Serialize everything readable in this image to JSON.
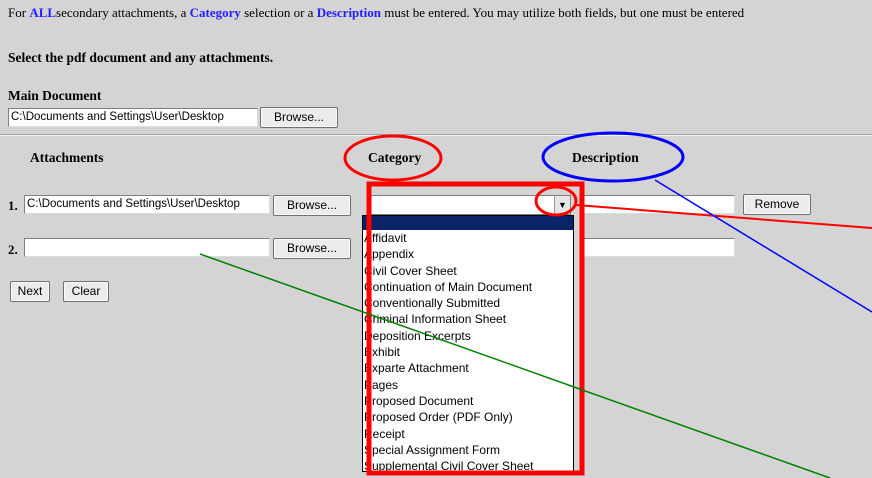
{
  "notice": {
    "prefix": "For ",
    "all": "ALL",
    "mid1": "secondary attachments, a ",
    "category": "Category",
    "mid2": " selection or a ",
    "description": "Description",
    "suffix": " must be entered. You may utilize both fields, but one must be entered"
  },
  "heading": "Select the pdf document and any attachments.",
  "main_document": {
    "label": "Main Document",
    "path": "C:\\Documents and Settings\\User\\Desktop",
    "browse": "Browse..."
  },
  "columns": {
    "attachments": "Attachments",
    "category": "Category",
    "description": "Description"
  },
  "attachments": [
    {
      "num": "1.",
      "path": "C:\\Documents and Settings\\User\\Desktop",
      "browse": "Browse...",
      "remove": "Remove",
      "description": ""
    },
    {
      "num": "2.",
      "path": "",
      "browse": "Browse...",
      "description": ""
    }
  ],
  "category_options": [
    "Affidavit",
    "Appendix",
    "Civil Cover Sheet",
    "Continuation of Main Document",
    "Conventionally Submitted",
    "Criminal Information Sheet",
    "Deposition Excerpts",
    "Exhibit",
    "Exparte Attachment",
    "Pages",
    "Proposed Document",
    "Proposed Order (PDF Only)",
    "Receipt",
    "Special Assignment Form",
    "Supplemental Civil Cover Sheet"
  ],
  "buttons": {
    "next": "Next",
    "clear": "Clear"
  },
  "colors": {
    "accent_blue": "#2020ff",
    "highlight_red": "#ff0000",
    "annotation_blue": "#0000ff",
    "annotation_green": "#008000"
  }
}
